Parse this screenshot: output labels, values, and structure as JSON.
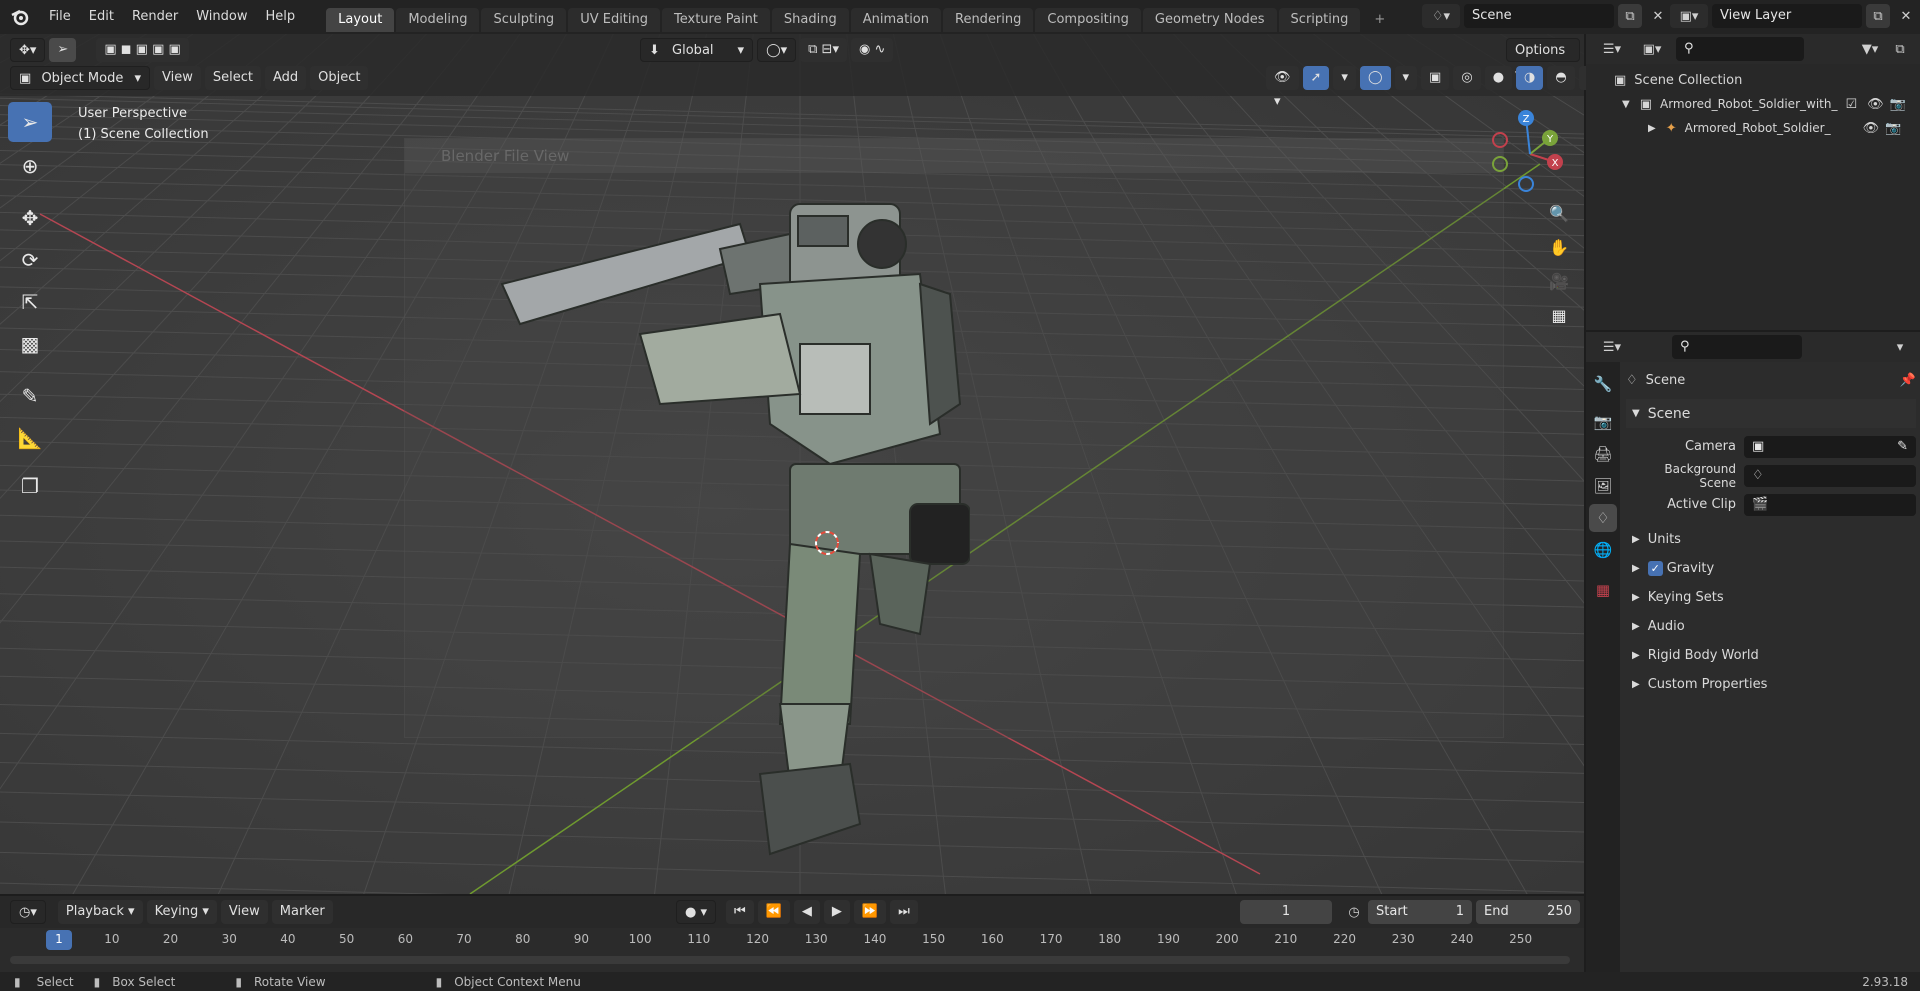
{
  "menu": [
    "File",
    "Edit",
    "Render",
    "Window",
    "Help"
  ],
  "workspaces": [
    "Layout",
    "Modeling",
    "Sculpting",
    "UV Editing",
    "Texture Paint",
    "Shading",
    "Animation",
    "Rendering",
    "Compositing",
    "Geometry Nodes",
    "Scripting"
  ],
  "active_workspace": "Layout",
  "scene_field": "Scene",
  "view_layer_field": "View Layer",
  "viewport": {
    "mode": "Object Mode",
    "menus": [
      "View",
      "Select",
      "Add",
      "Object"
    ],
    "transform_orientation": "Global",
    "options_label": "Options",
    "overlay_title": "User Perspective",
    "overlay_subtitle": "(1) Scene Collection",
    "file_view_ghost_title": "Blender File View",
    "gizmo_axes": {
      "x": "X",
      "y": "Y",
      "z": "Z"
    }
  },
  "outliner": {
    "root": "Scene Collection",
    "items": [
      {
        "label": "Armored_Robot_Soldier_with_",
        "level": 1
      },
      {
        "label": "Armored_Robot_Soldier_",
        "level": 2
      }
    ]
  },
  "properties": {
    "context_title": "Scene",
    "section_title": "Scene",
    "fields": [
      {
        "label": "Camera",
        "value": ""
      },
      {
        "label": "Background Scene",
        "value": ""
      },
      {
        "label": "Active Clip",
        "value": ""
      }
    ],
    "collapsed_panels": [
      "Units",
      "Gravity",
      "Keying Sets",
      "Audio",
      "Rigid Body World",
      "Custom Properties"
    ],
    "gravity_checked": true
  },
  "timeline": {
    "menus": [
      "Playback",
      "Keying",
      "View",
      "Marker"
    ],
    "current_frame": "1",
    "start_label": "Start",
    "start_value": "1",
    "end_label": "End",
    "end_value": "250",
    "ticks": [
      "1",
      "10",
      "20",
      "30",
      "40",
      "50",
      "60",
      "70",
      "80",
      "90",
      "100",
      "110",
      "120",
      "130",
      "140",
      "150",
      "160",
      "170",
      "180",
      "190",
      "200",
      "210",
      "220",
      "230",
      "240",
      "250"
    ]
  },
  "status": {
    "select": "Select",
    "box_select": "Box Select",
    "rotate_view": "Rotate View",
    "context_menu": "Object Context Menu",
    "version": "2.93.18"
  },
  "colors": {
    "accent": "#4772b3",
    "x_axis": "#c2414d",
    "y_axis": "#7aa33a",
    "z_axis": "#3a84d9"
  }
}
